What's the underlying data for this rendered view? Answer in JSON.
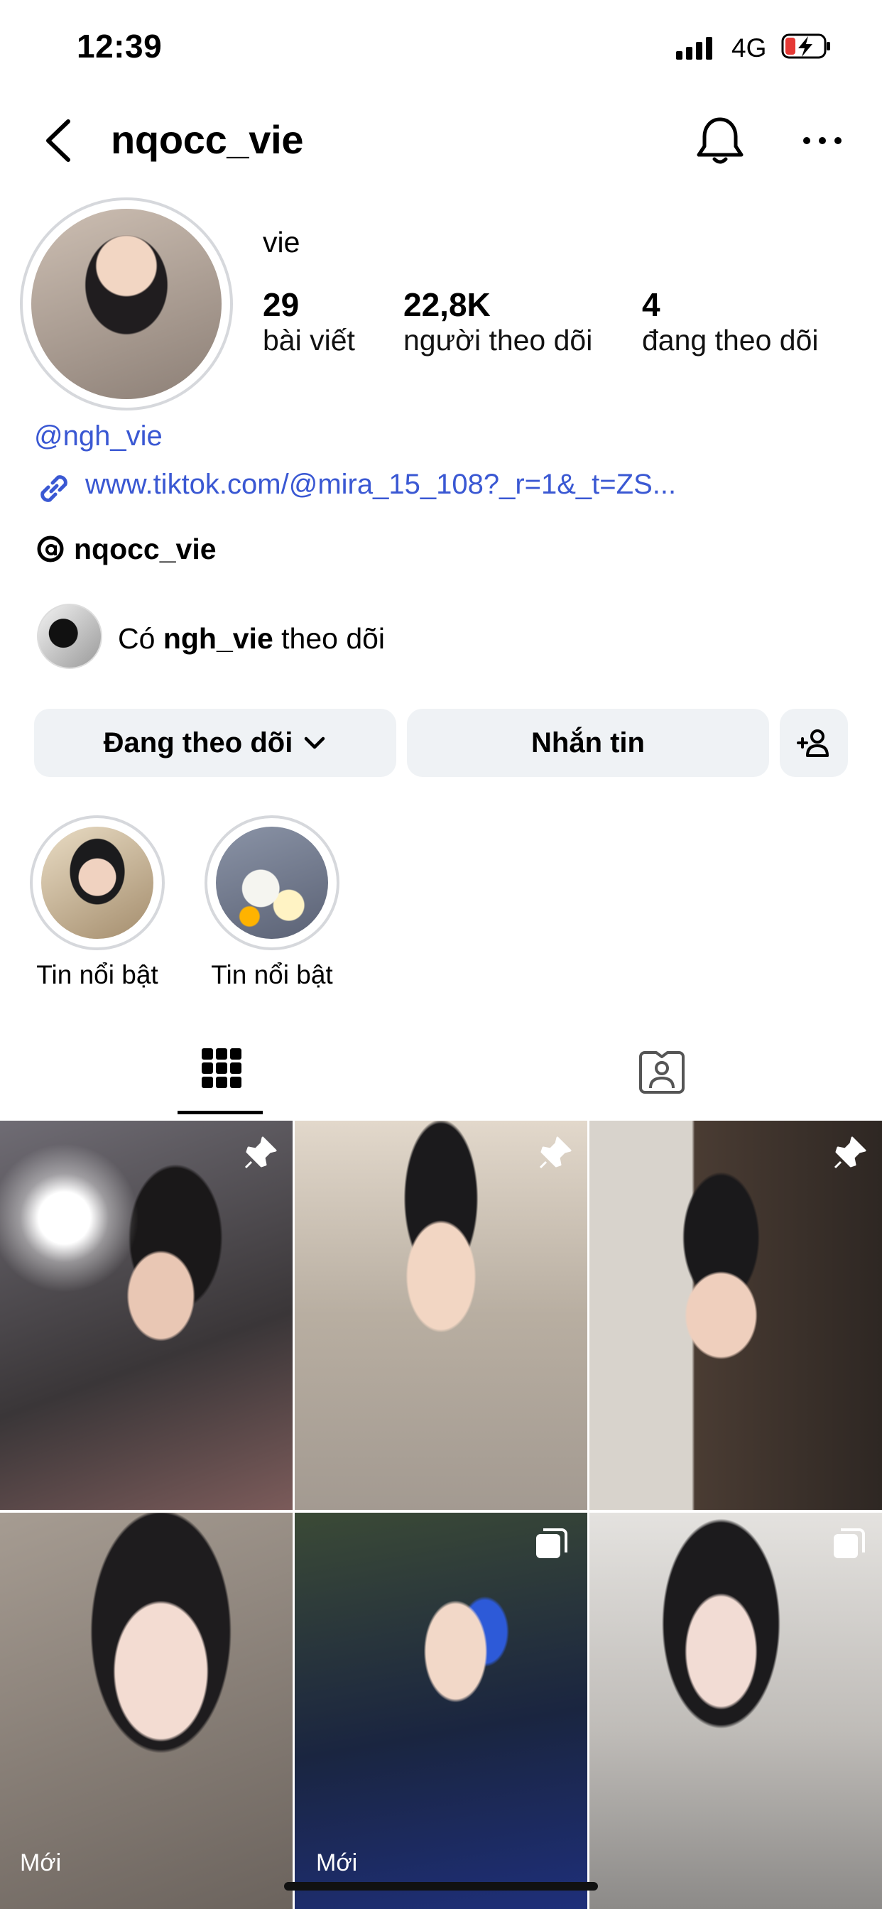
{
  "status_bar": {
    "time": "12:39",
    "network": "4G"
  },
  "header": {
    "username": "nqocc_vie"
  },
  "profile": {
    "display_name": "vie",
    "stats": [
      {
        "number": "29",
        "label": "bài viết"
      },
      {
        "number": "22,8K",
        "label": "người theo dõi"
      },
      {
        "number": "4",
        "label": "đang theo dõi"
      }
    ],
    "handle_link": "@ngh_vie",
    "external_link": "www.tiktok.com/@mira_15_108?_r=1&_t=ZS...",
    "threads_name": "nqocc_vie",
    "mutual": {
      "prefix": "Có ",
      "name": "ngh_vie",
      "suffix": " theo dõi"
    }
  },
  "actions": {
    "follow_label": "Đang theo dõi",
    "message_label": "Nhắn tin"
  },
  "highlights": [
    {
      "label": "Tin nổi bật"
    },
    {
      "label": "Tin nổi bật"
    }
  ],
  "grid": {
    "new_label": "Mới"
  },
  "colors": {
    "link": "#3a58d3",
    "button_bg": "#eff2f5",
    "ring": "#d6d8dc"
  }
}
